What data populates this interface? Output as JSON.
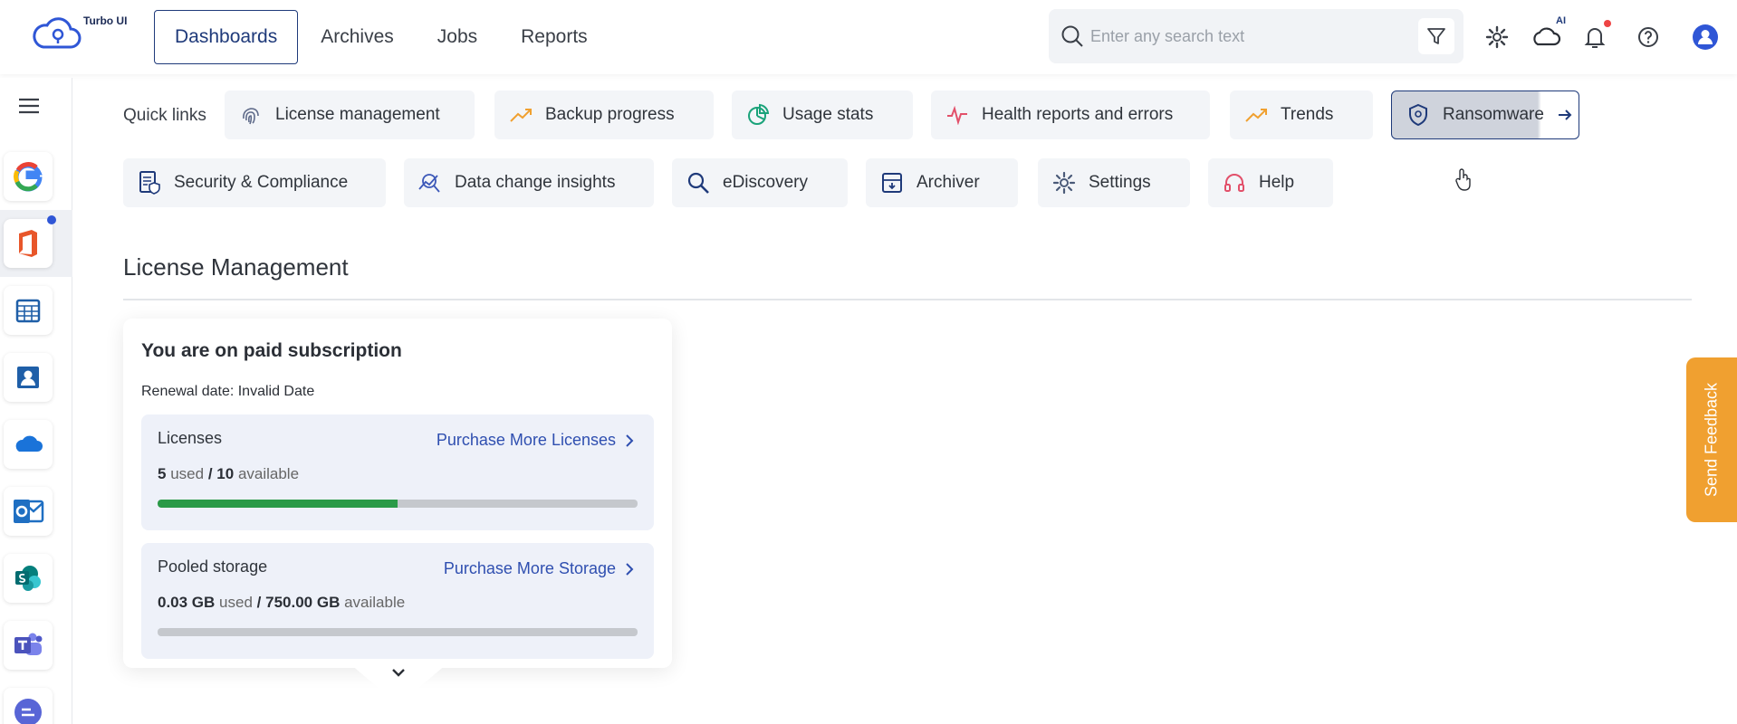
{
  "brand": {
    "name": "Turbo UI"
  },
  "nav": {
    "items": [
      "Dashboards",
      "Archives",
      "Jobs",
      "Reports"
    ],
    "active": "Dashboards"
  },
  "search": {
    "placeholder": "Enter any search text"
  },
  "header_icons": [
    "filter-icon",
    "gear-icon",
    "ai-cloud-icon",
    "bell-icon",
    "help-icon",
    "user-avatar-icon"
  ],
  "ai_badge": "AI",
  "sidebar": {
    "apps": [
      "google-icon",
      "office-icon",
      "calendar-icon",
      "contacts-icon",
      "onedrive-icon",
      "outlook-icon",
      "sharepoint-icon",
      "teams-icon",
      "chat-icon"
    ]
  },
  "quick_links": {
    "label": "Quick links",
    "row1": [
      "License management",
      "Backup progress",
      "Usage stats",
      "Health reports and errors",
      "Trends",
      "Ransomware"
    ],
    "row2": [
      "Security & Compliance",
      "Data change insights",
      "eDiscovery",
      "Archiver",
      "Settings",
      "Help"
    ]
  },
  "section": {
    "title": "License Management"
  },
  "subscription": {
    "title": "You are on paid subscription",
    "renewal": "Renewal date: Invalid Date",
    "licenses": {
      "label": "Licenses",
      "link": "Purchase More Licenses",
      "used": "5",
      "used_word": "used",
      "sep": "/",
      "available": "10",
      "available_word": "available",
      "fraction": 0.5
    },
    "storage": {
      "label": "Pooled storage",
      "link": "Purchase More Storage",
      "used": "0.03 GB",
      "used_word": "used",
      "sep": "/",
      "available": "750.00 GB",
      "available_word": "available",
      "fraction": 4e-05
    }
  },
  "feedback": {
    "label": "Send Feedback"
  },
  "colors": {
    "accent": "#1f3a7a",
    "link": "#2f4fb0",
    "progress": "#2a9a47",
    "feedback": "#f0a030"
  }
}
